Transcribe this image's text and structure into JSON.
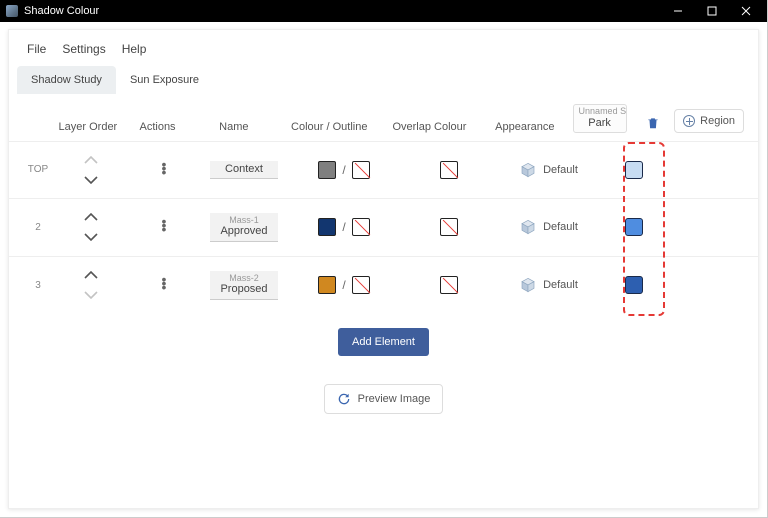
{
  "window": {
    "title": "Shadow Colour"
  },
  "menu": {
    "file": "File",
    "settings": "Settings",
    "help": "Help"
  },
  "tabs": {
    "shadow": "Shadow Study",
    "sun": "Sun Exposure",
    "active": 0
  },
  "headers": {
    "layer_order": "Layer Order",
    "actions": "Actions",
    "name": "Name",
    "colour": "Colour / Outline",
    "overlap": "Overlap Colour",
    "appearance": "Appearance"
  },
  "region_header": {
    "prefix": "Unnamed S",
    "name": "Park"
  },
  "add_region_label": "Region",
  "rows": [
    {
      "handle": "TOP",
      "name_prefix": "",
      "name": "Context",
      "colour": "#7f7f7f",
      "outline": "none",
      "overlap": "none",
      "appearance": "Default",
      "region_colour": "#c7dcf3",
      "up_dim": true,
      "down_dim": false
    },
    {
      "handle": "2",
      "name_prefix": "Mass-1",
      "name": "Approved",
      "colour": "#12366f",
      "outline": "none",
      "overlap": "none",
      "appearance": "Default",
      "region_colour": "#4f8de0",
      "up_dim": false,
      "down_dim": false
    },
    {
      "handle": "3",
      "name_prefix": "Mass-2",
      "name": "Proposed",
      "colour": "#d08820",
      "outline": "none",
      "overlap": "none",
      "appearance": "Default",
      "region_colour": "#2d5fb0",
      "up_dim": false,
      "down_dim": true
    }
  ],
  "buttons": {
    "add_element": "Add Element",
    "preview": "Preview Image"
  }
}
